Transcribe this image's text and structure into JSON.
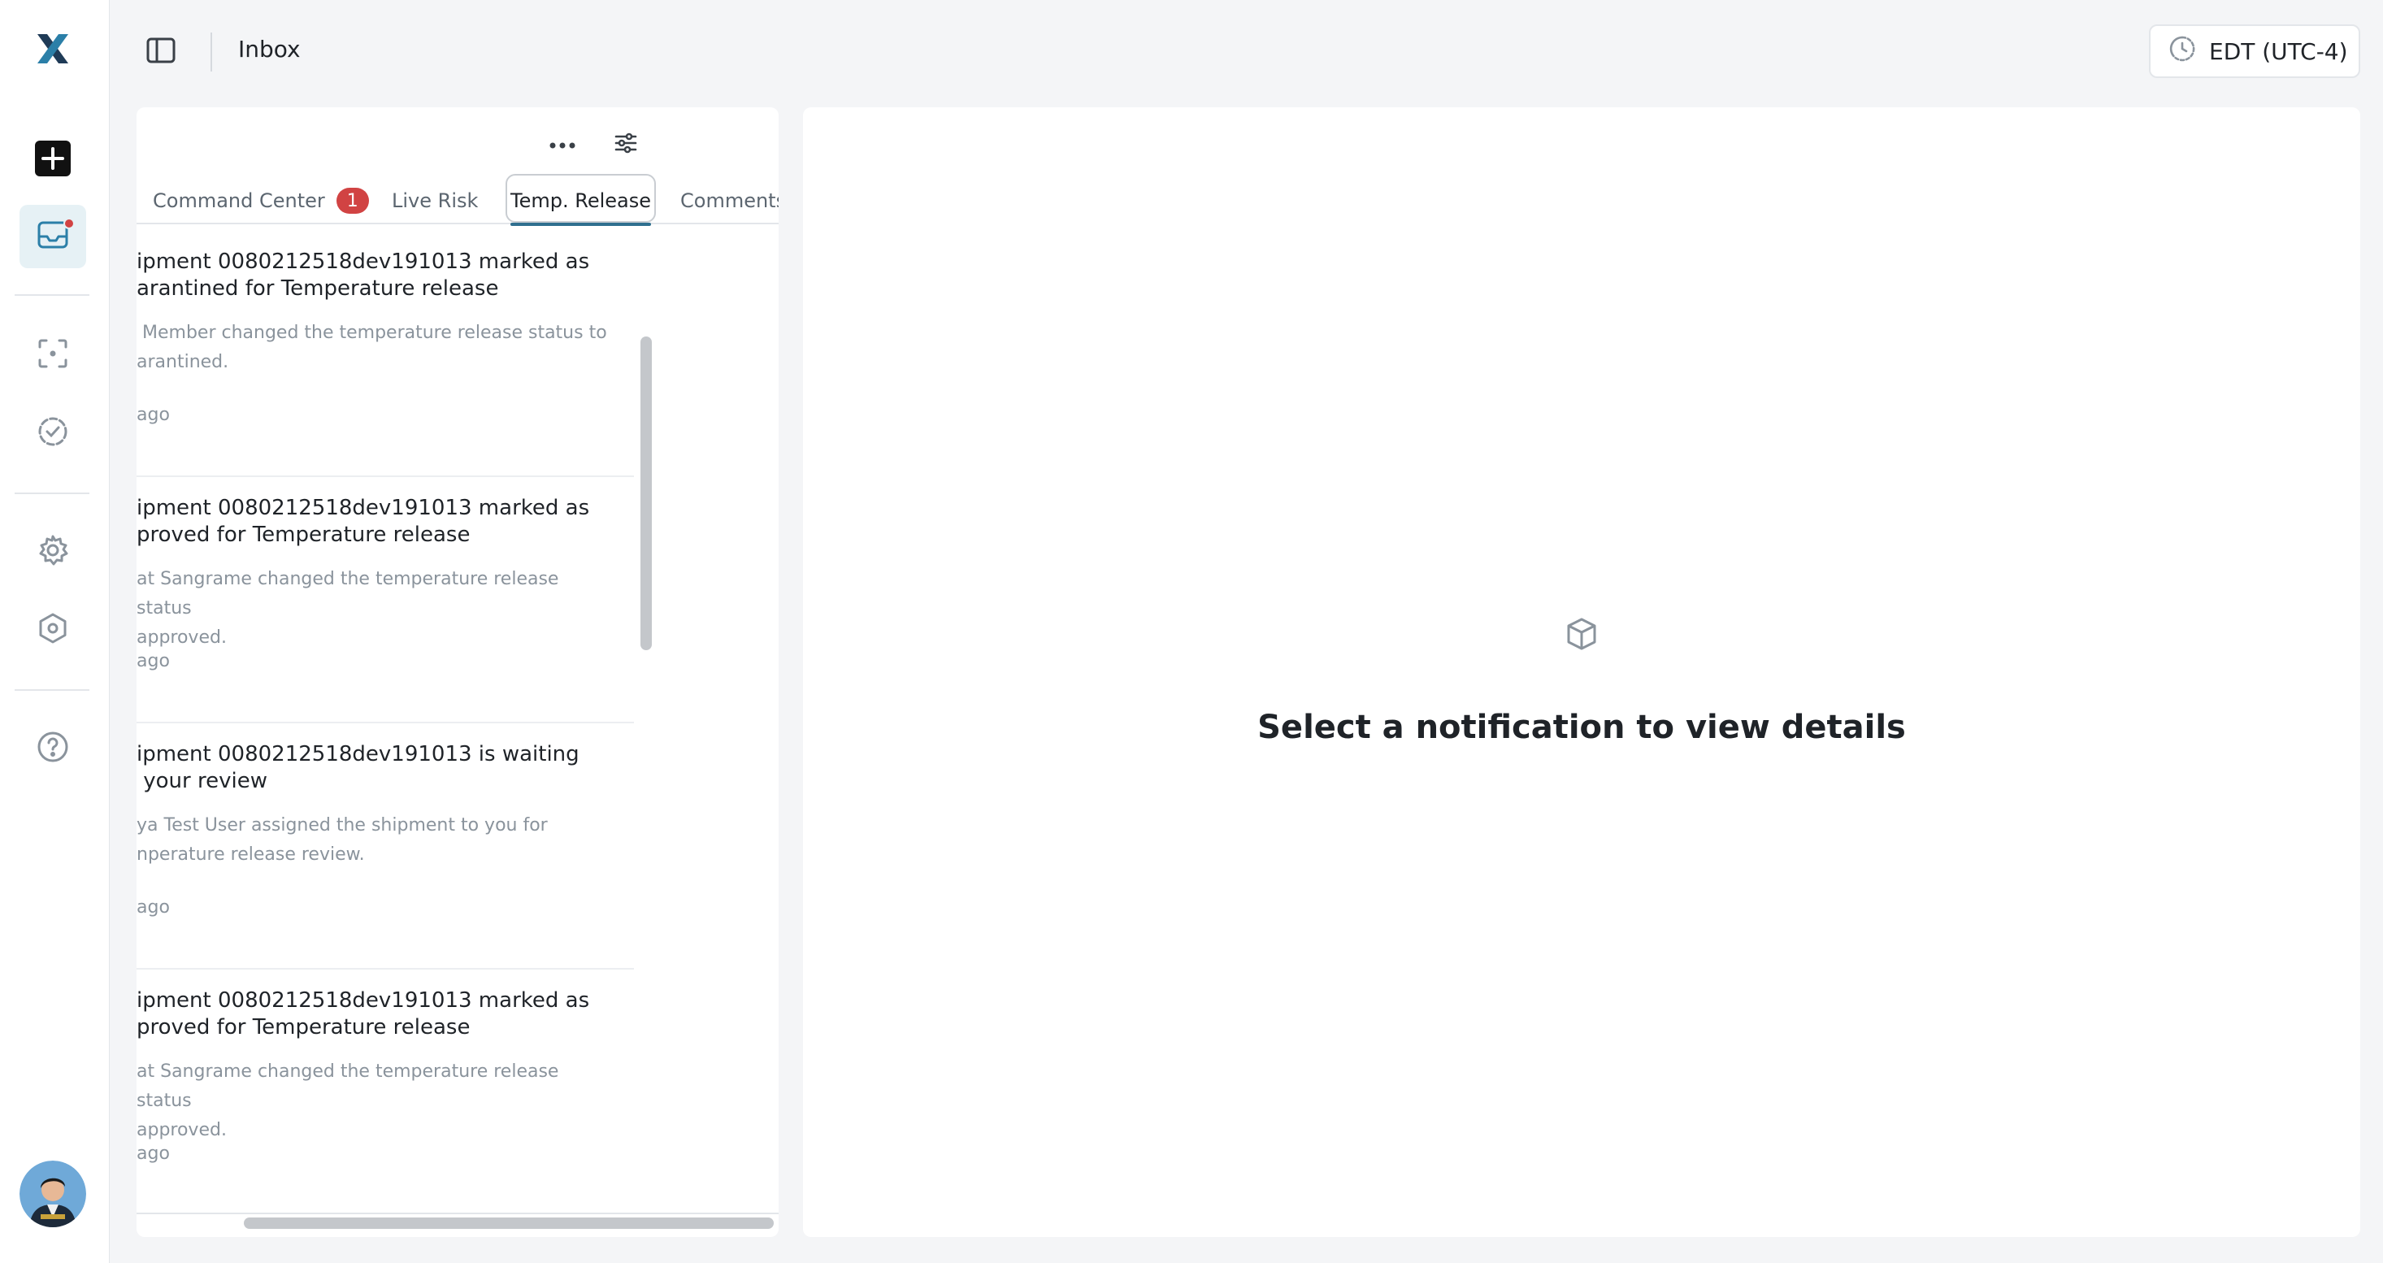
{
  "header": {
    "title": "Inbox",
    "timezone": "EDT (UTC-4)"
  },
  "rail": {
    "items": [
      {
        "name": "create",
        "icon": "plus-square-icon"
      },
      {
        "name": "inbox",
        "icon": "inbox-icon",
        "active": true,
        "has_badge": true
      },
      {
        "name": "scan",
        "icon": "scan-icon"
      },
      {
        "name": "review",
        "icon": "check-circle-dashed-icon"
      },
      {
        "name": "settings",
        "icon": "gear-icon"
      },
      {
        "name": "admin",
        "icon": "hexagon-icon"
      },
      {
        "name": "help",
        "icon": "help-icon"
      }
    ]
  },
  "tabs": [
    {
      "label": "Command Center",
      "badge": "1"
    },
    {
      "label": "Live Risk"
    },
    {
      "label": "Temp. Release",
      "active": true
    },
    {
      "label": "Comments"
    }
  ],
  "notifications": [
    {
      "title": "ipment 0080212518dev191013 marked as arantined for Temperature release",
      "title_lines": [
        "ipment 0080212518dev191013 marked as",
        "arantined for Temperature release"
      ],
      "desc_lines": [
        " Member changed the temperature release status to",
        "arantined."
      ],
      "time": "ago"
    },
    {
      "title_lines": [
        "ipment 0080212518dev191013 marked as",
        "proved for Temperature release"
      ],
      "desc_lines": [
        "at Sangrame changed the temperature release status",
        "approved."
      ],
      "time": "ago"
    },
    {
      "title_lines": [
        "ipment 0080212518dev191013 is waiting",
        " your review"
      ],
      "desc_lines": [
        "ya Test User assigned the shipment to you for",
        "nperature release review."
      ],
      "time": "ago"
    },
    {
      "title_lines": [
        "ipment 0080212518dev191013 marked as",
        "proved for Temperature release"
      ],
      "desc_lines": [
        "at Sangrame changed the temperature release status",
        "approved."
      ],
      "time": "ago"
    }
  ],
  "detail": {
    "empty_message": "Select a notification to view details",
    "icon": "package-icon"
  },
  "colors": {
    "accent": "#2f6f8f",
    "badge": "#d14343",
    "active_rail_bg": "#e6f1f5"
  }
}
